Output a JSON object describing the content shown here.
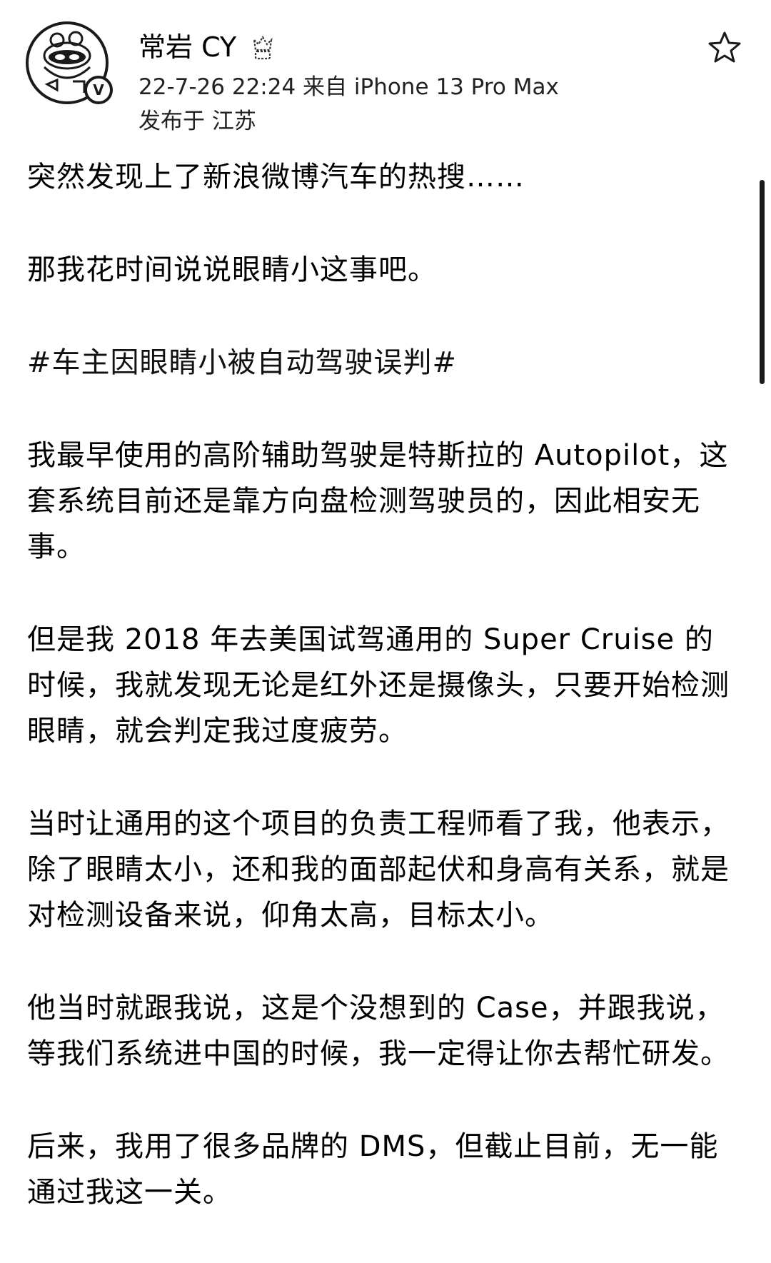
{
  "header": {
    "user_name": "常岩 CY",
    "timestamp_source": "22-7-26 22:24  来自 iPhone 13 Pro Max",
    "location": "发布于 江苏",
    "icons": {
      "avatar": "user-avatar",
      "verified": "verified-badge-icon",
      "member": "member-crown-icon",
      "favorite": "star-icon"
    },
    "verified_mark": "V"
  },
  "post": {
    "paragraphs": [
      "突然发现上了新浪微博汽车的热搜……",
      "那我花时间说说眼睛小这事吧。",
      "#车主因眼睛小被自动驾驶误判#",
      "我最早使用的高阶辅助驾驶是特斯拉的 Autopilot，这套系统目前还是靠方向盘检测驾驶员的，因此相安无事。",
      "但是我 2018 年去美国试驾通用的 Super Cruise 的时候，我就发现无论是红外还是摄像头，只要开始检测眼睛，就会判定我过度疲劳。",
      "当时让通用的这个项目的负责工程师看了我，他表示，除了眼睛太小，还和我的面部起伏和身高有关系，就是对检测设备来说，仰角太高，目标太小。",
      "他当时就跟我说，这是个没想到的 Case，并跟我说，等我们系统进中国的时候，我一定得让你去帮忙研发。",
      "后来，我用了很多品牌的 DMS，但截止目前，无一能通过我这一关。"
    ]
  },
  "colors": {
    "text": "#000000",
    "meta_text": "#222222",
    "background": "#ffffff"
  }
}
